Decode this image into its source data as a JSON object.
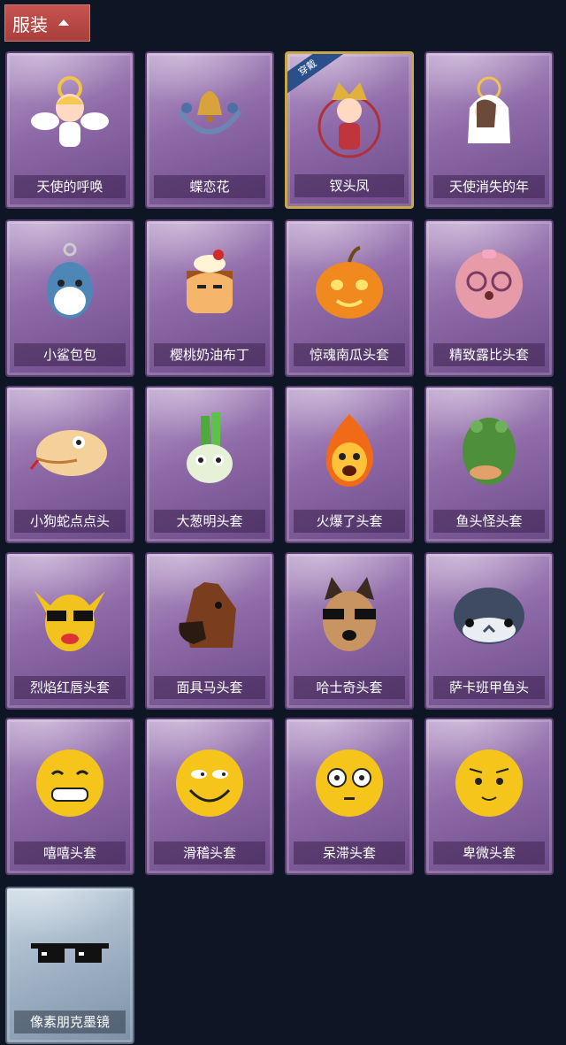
{
  "header": {
    "title": "服装"
  },
  "equipped_badge": "穿戴",
  "items": [
    {
      "label": "天使的呼唤",
      "icon": "angel-figure-icon",
      "style": "purple",
      "equipped": false
    },
    {
      "label": "蝶恋花",
      "icon": "bell-wreath-icon",
      "style": "purple",
      "equipped": false
    },
    {
      "label": "钗头凤",
      "icon": "phoenix-crown-figure-icon",
      "style": "purple",
      "equipped": true
    },
    {
      "label": "天使消失的年",
      "icon": "veiled-angel-icon",
      "style": "purple",
      "equipped": false
    },
    {
      "label": "小鲨包包",
      "icon": "shark-bag-icon",
      "style": "purple",
      "equipped": false
    },
    {
      "label": "樱桃奶油布丁",
      "icon": "pudding-head-icon",
      "style": "purple",
      "equipped": false
    },
    {
      "label": "惊魂南瓜头套",
      "icon": "pumpkin-head-icon",
      "style": "purple",
      "equipped": false
    },
    {
      "label": "精致露比头套",
      "icon": "pink-beaver-head-icon",
      "style": "purple",
      "equipped": false
    },
    {
      "label": "小狗蛇点点头",
      "icon": "snake-head-icon",
      "style": "purple",
      "equipped": false
    },
    {
      "label": "大葱明头套",
      "icon": "scallion-head-icon",
      "style": "purple",
      "equipped": false
    },
    {
      "label": "火爆了头套",
      "icon": "fire-head-icon",
      "style": "purple",
      "equipped": false
    },
    {
      "label": "鱼头怪头套",
      "icon": "fish-head-icon",
      "style": "purple",
      "equipped": false
    },
    {
      "label": "烈焰红唇头套",
      "icon": "yellow-mouse-sunglasses-icon",
      "style": "purple",
      "equipped": false
    },
    {
      "label": "面具马头套",
      "icon": "horse-head-icon",
      "style": "purple",
      "equipped": false
    },
    {
      "label": "哈士奇头套",
      "icon": "husky-sunglasses-icon",
      "style": "purple",
      "equipped": false
    },
    {
      "label": "萨卡班甲鱼头",
      "icon": "sacabambaspis-head-icon",
      "style": "purple",
      "equipped": false
    },
    {
      "label": "嘻嘻头套",
      "icon": "grin-emoji-head-icon",
      "style": "purple",
      "equipped": false
    },
    {
      "label": "滑稽头套",
      "icon": "funny-emoji-head-icon",
      "style": "purple",
      "equipped": false
    },
    {
      "label": "呆滞头套",
      "icon": "dazed-emoji-head-icon",
      "style": "purple",
      "equipped": false
    },
    {
      "label": "卑微头套",
      "icon": "humble-emoji-head-icon",
      "style": "purple",
      "equipped": false
    },
    {
      "label": "像素朋克墨镜",
      "icon": "pixel-sunglasses-icon",
      "style": "silver",
      "equipped": false
    }
  ]
}
